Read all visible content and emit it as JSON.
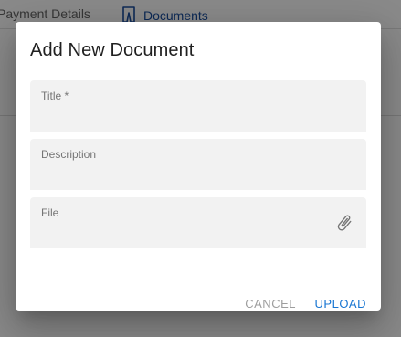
{
  "background": {
    "tabs": [
      {
        "label": "Payment Details"
      },
      {
        "label": "Documents"
      }
    ]
  },
  "dialog": {
    "title": "Add New Document",
    "fields": {
      "title": {
        "label": "Title *",
        "value": ""
      },
      "description": {
        "label": "Description",
        "value": ""
      },
      "file": {
        "label": "File",
        "value": ""
      }
    },
    "attach_icon": "paperclip-icon",
    "buttons": {
      "cancel": "CANCEL",
      "upload": "UPLOAD"
    }
  },
  "colors": {
    "accent": "#1976d2",
    "tab_active": "#1a4fa0",
    "disabled_text": "#9e9e9e",
    "field_fill": "#f2f2f2"
  }
}
